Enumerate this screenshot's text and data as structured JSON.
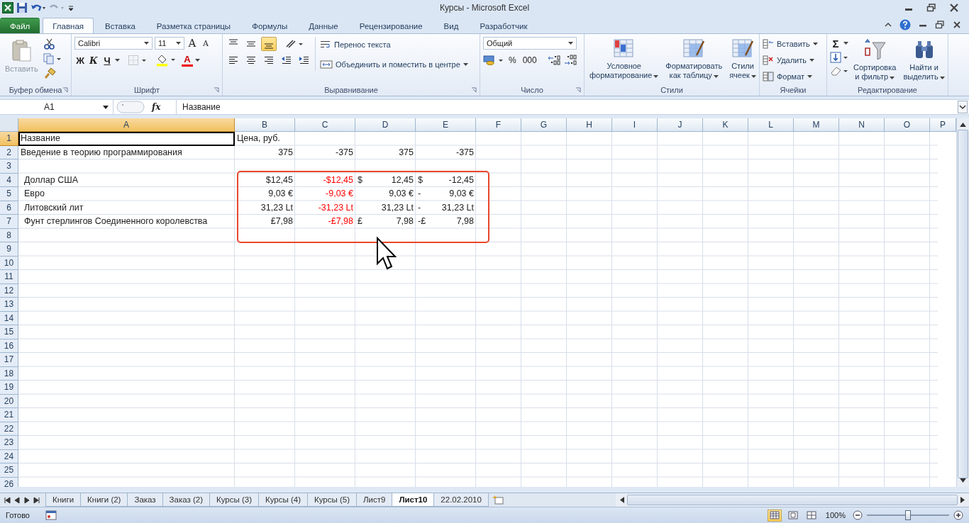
{
  "window": {
    "title": "Курсы - Microsoft Excel"
  },
  "tabs": [
    {
      "label": "Файл",
      "kind": "file",
      "selected": false
    },
    {
      "label": "Главная",
      "kind": "tab",
      "selected": true
    },
    {
      "label": "Вставка",
      "kind": "tab",
      "selected": false
    },
    {
      "label": "Разметка страницы",
      "kind": "tab",
      "selected": false
    },
    {
      "label": "Формулы",
      "kind": "tab",
      "selected": false
    },
    {
      "label": "Данные",
      "kind": "tab",
      "selected": false
    },
    {
      "label": "Рецензирование",
      "kind": "tab",
      "selected": false
    },
    {
      "label": "Вид",
      "kind": "tab",
      "selected": false
    },
    {
      "label": "Разработчик",
      "kind": "tab",
      "selected": false
    }
  ],
  "clipboard": {
    "title": "Буфер обмена",
    "paste": "Вставить"
  },
  "font": {
    "title": "Шрифт",
    "name": "Calibri",
    "size": "11",
    "grow": "A",
    "shrink": "A",
    "bold": "Ж",
    "italic": "К",
    "underline": "Ч",
    "color_letter": "A"
  },
  "alignment": {
    "title": "Выравнивание",
    "vertical": [
      {
        "selected": false
      },
      {
        "selected": false
      },
      {
        "selected": true
      }
    ],
    "wrap": "Перенос текста",
    "merge": "Объединить и поместить в центре"
  },
  "number": {
    "title": "Число",
    "format": "Общий",
    "percent": "%",
    "thousands": "000"
  },
  "styles": {
    "title": "Стили",
    "buttons": [
      {
        "lines": [
          "Условное",
          "форматирование"
        ]
      },
      {
        "lines": [
          "Форматировать",
          "как таблицу"
        ]
      },
      {
        "lines": [
          "Стили",
          "ячеек"
        ]
      }
    ]
  },
  "cells": {
    "title": "Ячейки",
    "buttons": [
      "Вставить",
      "Удалить",
      "Формат"
    ]
  },
  "editing": {
    "title": "Редактирование",
    "sum": "Σ",
    "buttons": [
      {
        "lines": [
          "Сортировка",
          "и фильтр"
        ]
      },
      {
        "lines": [
          "Найти и",
          "выделить"
        ]
      }
    ]
  },
  "formula_bar": {
    "name_box": "A1",
    "function_label": "fx",
    "content": "Название"
  },
  "grid": {
    "columns": [
      "A",
      "B",
      "C",
      "D",
      "E",
      "F",
      "G",
      "H",
      "I",
      "J",
      "K",
      "L",
      "M",
      "N",
      "O",
      "P"
    ],
    "rows": [
      {
        "num": "1",
        "cells": [
          {
            "text": "Название",
            "kind": "text",
            "selected": true
          },
          {
            "text": "Цена, руб.",
            "kind": "text",
            "selected": false
          }
        ]
      },
      {
        "num": "2",
        "cells": [
          {
            "text": "Введение в теорию программирования",
            "kind": "text",
            "selected": false
          },
          {
            "text": "375",
            "kind": "number",
            "selected": false
          },
          {
            "text": "-375",
            "kind": "number",
            "selected": false
          },
          {
            "text": "375",
            "kind": "number",
            "selected": false
          },
          {
            "text": "-375",
            "kind": "number",
            "selected": false
          }
        ]
      },
      {
        "num": "3",
        "cells": []
      },
      {
        "num": "4",
        "cells": [
          {
            "text": "Доллар США",
            "kind": "indented",
            "selected": false
          },
          {
            "text": "$12,45",
            "kind": "number",
            "selected": false
          },
          {
            "text": "-$12,45",
            "kind": "number",
            "color": "#ff0000",
            "selected": false
          },
          {
            "symbol": "$",
            "text": "12,45",
            "kind": "accounting",
            "selected": false
          },
          {
            "symbol": "$",
            "text": "-12,45",
            "kind": "accounting",
            "selected": false
          }
        ]
      },
      {
        "num": "5",
        "cells": [
          {
            "text": "Евро",
            "kind": "indented",
            "selected": false
          },
          {
            "text": "9,03 €",
            "kind": "number",
            "selected": false
          },
          {
            "text": "-9,03 €",
            "kind": "number",
            "color": "#ff0000",
            "selected": false
          },
          {
            "text": "9,03 €",
            "kind": "number",
            "selected": false
          },
          {
            "symbol": "-",
            "text": "9,03 €",
            "kind": "accounting",
            "selected": false
          }
        ]
      },
      {
        "num": "6",
        "cells": [
          {
            "text": "Литовский лит",
            "kind": "indented",
            "selected": false
          },
          {
            "text": "31,23 Lt",
            "kind": "number",
            "selected": false
          },
          {
            "text": "-31,23 Lt",
            "kind": "number",
            "color": "#ff0000",
            "selected": false
          },
          {
            "text": "31,23 Lt",
            "kind": "number",
            "selected": false
          },
          {
            "symbol": "-",
            "text": "31,23 Lt",
            "kind": "accounting",
            "selected": false
          }
        ]
      },
      {
        "num": "7",
        "cells": [
          {
            "text": "Фунт стерлингов Соединенного королевства",
            "kind": "indented",
            "selected": false
          },
          {
            "text": "£7,98",
            "kind": "number",
            "selected": false
          },
          {
            "text": "-£7,98",
            "kind": "number",
            "color": "#ff0000",
            "selected": false
          },
          {
            "symbol": "£",
            "text": "7,98",
            "kind": "accounting",
            "selected": false
          },
          {
            "symbol": "-£",
            "text": "7,98",
            "kind": "accounting",
            "selected": false
          }
        ]
      },
      {
        "num": "8",
        "cells": []
      },
      {
        "num": "9",
        "cells": []
      },
      {
        "num": "10",
        "cells": []
      },
      {
        "num": "11",
        "cells": []
      },
      {
        "num": "12",
        "cells": []
      },
      {
        "num": "13",
        "cells": []
      },
      {
        "num": "14",
        "cells": []
      },
      {
        "num": "15",
        "cells": []
      },
      {
        "num": "16",
        "cells": []
      },
      {
        "num": "17",
        "cells": []
      },
      {
        "num": "18",
        "cells": []
      },
      {
        "num": "19",
        "cells": []
      },
      {
        "num": "20",
        "cells": []
      },
      {
        "num": "21",
        "cells": []
      },
      {
        "num": "22",
        "cells": []
      },
      {
        "num": "23",
        "cells": []
      },
      {
        "num": "24",
        "cells": []
      },
      {
        "num": "25",
        "cells": []
      },
      {
        "num": "26",
        "cells": []
      }
    ]
  },
  "sheet_tabs": [
    {
      "label": "Книги",
      "selected": false
    },
    {
      "label": "Книги (2)",
      "selected": false
    },
    {
      "label": "Заказ",
      "selected": false
    },
    {
      "label": "Заказ (2)",
      "selected": false
    },
    {
      "label": "Курсы (3)",
      "selected": false
    },
    {
      "label": "Курсы (4)",
      "selected": false
    },
    {
      "label": "Курсы (5)",
      "selected": false
    },
    {
      "label": "Лист9",
      "selected": false
    },
    {
      "label": "Лист10",
      "selected": true
    },
    {
      "label": "22.02.2010",
      "selected": false
    }
  ],
  "status_bar": {
    "text": "Готово",
    "views": [
      {
        "selected": true
      },
      {
        "selected": false
      },
      {
        "selected": false
      }
    ],
    "zoom": "100%",
    "zoom_slider": {
      "level": 0.5
    }
  }
}
